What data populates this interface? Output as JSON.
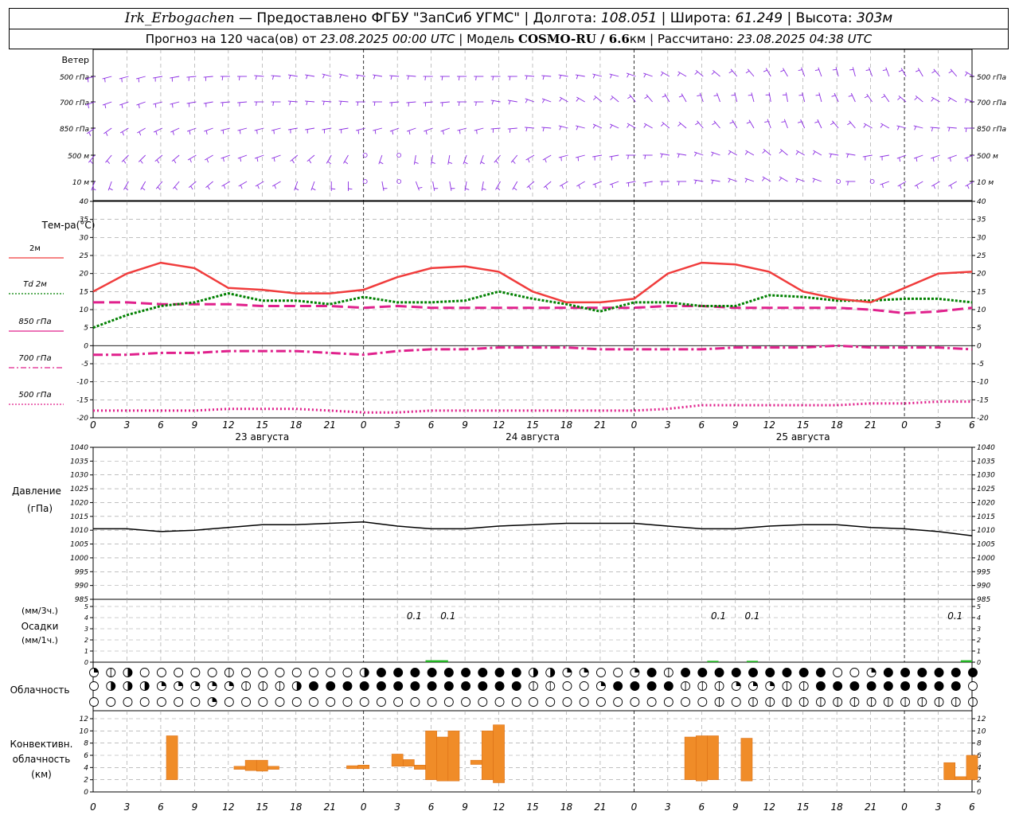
{
  "header": {
    "station": "Irk_Erbogachen",
    "provider": " — Предоставлено ФГБУ \"ЗапСиб УГМС\" | Долгота: ",
    "lon": "108.051",
    "lat_label": " | Широта: ",
    "lat": "61.249",
    "alt_label": " | Высота: ",
    "alt": "303м",
    "forecast_label": "Прогноз на 120 часа(ов) от ",
    "forecast_from": "23.08.2025 00:00 UTC",
    "model_label": " | Модель ",
    "model": "COSMO-RU / 6.6",
    "model_unit": "км",
    "computed_label": " | Рассчитано: ",
    "computed": "23.08.2025 04:38 UTC"
  },
  "labels": {
    "wind": "Ветер",
    "wind_levels": [
      "500 гПа",
      "700 гПа",
      "850 гПа",
      "500 м",
      "10  м"
    ],
    "temp": "Тем-ра(°С)",
    "legend": [
      "2м",
      "Td  2м",
      "850 гПа",
      "700 гПа",
      "500 гПа"
    ],
    "pressure": "Давление",
    "pressure_unit": "(гПа)",
    "precip_unit3": "(мм/3ч.)",
    "precip": "Осадки",
    "precip_unit1": "(мм/1ч.)",
    "cloud": "Облачность",
    "conv": [
      "Конвективн.",
      "облачность",
      "(км)"
    ]
  },
  "colors": {
    "t2m": "#f03c3c",
    "td2m": "#008000",
    "t850": "#e0208c",
    "t700": "#e0208c",
    "t500": "#e0208c",
    "wind": "#8a2be2",
    "precip": "#22b322",
    "conv": "#f08c28"
  },
  "chart_data": {
    "type": "meteogram",
    "x_ticks": [
      "0",
      "3",
      "6",
      "9",
      "12",
      "15",
      "18",
      "21",
      "0",
      "3",
      "6",
      "9",
      "12",
      "15",
      "18",
      "21",
      "0",
      "3",
      "6",
      "9",
      "12",
      "15",
      "18",
      "21",
      "0",
      "3",
      "6"
    ],
    "dates": [
      "23 августа",
      "24 августа",
      "25 августа"
    ],
    "temperature": {
      "ylim": [
        -20,
        40
      ],
      "ticks": [
        "40",
        "35",
        "30",
        "25",
        "20",
        "15",
        "10",
        "5",
        "0",
        "-5",
        "-10",
        "-15",
        "-20"
      ],
      "hours": [
        0,
        3,
        6,
        9,
        12,
        15,
        18,
        21,
        24,
        27,
        30,
        33,
        36,
        39,
        42,
        45,
        48,
        51,
        54,
        57,
        60,
        63,
        66,
        69,
        72,
        75,
        78
      ],
      "t2m": [
        15,
        20,
        23,
        21.5,
        16,
        15.5,
        14.5,
        14.5,
        15.5,
        19,
        21.5,
        22,
        20.5,
        15,
        12,
        12,
        13,
        20,
        23,
        22.5,
        20.5,
        15,
        13,
        12,
        16,
        20,
        20.5
      ],
      "td2m": [
        5,
        8.5,
        11,
        12,
        14.5,
        12.5,
        12.5,
        11.5,
        13.5,
        12,
        12,
        12.5,
        15,
        13,
        11.5,
        9.5,
        12,
        12,
        11,
        11,
        14,
        13.5,
        12.5,
        12.5,
        13,
        13,
        12
      ],
      "t850": [
        12,
        12,
        11.5,
        11.5,
        11.5,
        11,
        11,
        11,
        10.5,
        11,
        10.5,
        10.5,
        10.5,
        10.5,
        10.5,
        10.5,
        10.5,
        11,
        11,
        10.5,
        10.5,
        10.5,
        10.5,
        10,
        9,
        9.5,
        10.5
      ],
      "t700": [
        -2.5,
        -2.5,
        -2,
        -2,
        -1.5,
        -1.5,
        -1.5,
        -2,
        -2.5,
        -1.5,
        -1,
        -1,
        -0.5,
        -0.5,
        -0.5,
        -1,
        -1,
        -1,
        -1,
        -0.5,
        -0.5,
        -0.5,
        0,
        -0.5,
        -0.5,
        -0.5,
        -1
      ],
      "t500": [
        -18,
        -18,
        -18,
        -18,
        -17.5,
        -17.5,
        -17.5,
        -18,
        -18.5,
        -18.5,
        -18,
        -18,
        -18,
        -18,
        -18,
        -18,
        -18,
        -17.5,
        -16.5,
        -16.5,
        -16.5,
        -16.5,
        -16.5,
        -16,
        -16,
        -15.5,
        -15.5
      ]
    },
    "pressure": {
      "ylim": [
        985,
        1040
      ],
      "ticks": [
        "1040",
        "1035",
        "1030",
        "1025",
        "1020",
        "1015",
        "1010",
        "1005",
        "1000",
        "995",
        "990",
        "985"
      ],
      "hours": [
        0,
        3,
        6,
        9,
        12,
        15,
        18,
        21,
        24,
        27,
        30,
        33,
        36,
        39,
        42,
        45,
        48,
        51,
        54,
        57,
        60,
        63,
        66,
        69,
        72,
        75,
        78
      ],
      "values": [
        1010.5,
        1010.5,
        1009.5,
        1010,
        1011,
        1012,
        1012,
        1012.5,
        1013,
        1011.5,
        1010.5,
        1010.5,
        1011.5,
        1012,
        1012.5,
        1012.5,
        1012.5,
        1011.5,
        1010.5,
        1010.5,
        1011.5,
        1012,
        1012,
        1011,
        1010.5,
        1009.5,
        1008
      ]
    },
    "precipitation": {
      "ticks": [
        "5",
        "4",
        "3",
        "2",
        "1",
        "0"
      ],
      "labels": [
        {
          "hour": 28.5,
          "text": "0.1"
        },
        {
          "hour": 31.5,
          "text": "0.1"
        },
        {
          "hour": 55.5,
          "text": "0.1"
        },
        {
          "hour": 58.5,
          "text": "0.1"
        },
        {
          "hour": 76.5,
          "text": "0.1"
        }
      ],
      "bars": [
        {
          "from": 29.5,
          "to": 31.5,
          "value": 0.1
        },
        {
          "from": 54.5,
          "to": 55.5,
          "value": 0.05
        },
        {
          "from": 58,
          "to": 59,
          "value": 0.05
        },
        {
          "from": 77,
          "to": 78,
          "value": 0.1
        }
      ]
    },
    "convective_cloud": {
      "ylim": [
        0,
        13
      ],
      "ticks": [
        "12",
        "10",
        "8",
        "6",
        "4",
        "2",
        "0"
      ],
      "bars": [
        {
          "hour": 7,
          "base": 2,
          "top": 9.2
        },
        {
          "hour": 13,
          "base": 3.7,
          "top": 4.2
        },
        {
          "hour": 14,
          "base": 3.5,
          "top": 5.2
        },
        {
          "hour": 15,
          "base": 3.4,
          "top": 5.2
        },
        {
          "hour": 16,
          "base": 3.7,
          "top": 4.2
        },
        {
          "hour": 23,
          "base": 3.8,
          "top": 4.3
        },
        {
          "hour": 24,
          "base": 3.8,
          "top": 4.4
        },
        {
          "hour": 27,
          "base": 4.2,
          "top": 6.2
        },
        {
          "hour": 28,
          "base": 4.2,
          "top": 5.3
        },
        {
          "hour": 29,
          "base": 3.7,
          "top": 4.4
        },
        {
          "hour": 30,
          "base": 2,
          "top": 10
        },
        {
          "hour": 31,
          "base": 1.8,
          "top": 9
        },
        {
          "hour": 32,
          "base": 1.8,
          "top": 10
        },
        {
          "hour": 34,
          "base": 4.5,
          "top": 5.2
        },
        {
          "hour": 35,
          "base": 2,
          "top": 10
        },
        {
          "hour": 36,
          "base": 1.5,
          "top": 11
        },
        {
          "hour": 53,
          "base": 2,
          "top": 9
        },
        {
          "hour": 54,
          "base": 1.8,
          "top": 9.2
        },
        {
          "hour": 55,
          "base": 2,
          "top": 9.2
        },
        {
          "hour": 58,
          "base": 1.8,
          "top": 8.8
        },
        {
          "hour": 76,
          "base": 2,
          "top": 4.8
        },
        {
          "hour": 77,
          "base": 2,
          "top": 2.5
        },
        {
          "hour": 78,
          "base": 2,
          "top": 6
        }
      ]
    },
    "cloudiness_rows": 3
  }
}
